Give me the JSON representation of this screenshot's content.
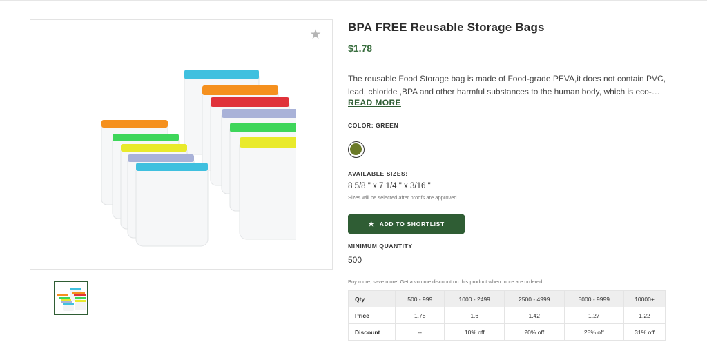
{
  "product": {
    "title": "BPA FREE Reusable Storage Bags",
    "price": "$1.78",
    "description": "The reusable Food Storage bag is made of Food-grade PEVA,it does not contain PVC, lead, chloride ,BPA and other harmful substances to the human body, which is eco-…",
    "read_more": "READ MORE"
  },
  "icons": {
    "favorite": "star-icon",
    "shortlist": "star-icon"
  },
  "color": {
    "label": "COLOR: GREEN",
    "swatches": [
      {
        "name": "Green",
        "hex": "#6b7a28",
        "selected": true
      }
    ]
  },
  "sizes": {
    "label": "AVAILABLE SIZES:",
    "value": "8 5/8 \" x 7 1/4 \" x 3/16 \"",
    "note": "Sizes will be selected after proofs are approved"
  },
  "shortlist": {
    "label": "ADD TO SHORTLIST",
    "color": "#2f5d34"
  },
  "minimum_quantity": {
    "label": "MINIMUM QUANTITY",
    "value": "500"
  },
  "volume": {
    "note": "Buy more, save more! Get a volume discount on this product when more are ordered.",
    "rows": [
      {
        "label": "Qty",
        "cells": [
          "500 - 999",
          "1000 - 2499",
          "2500 - 4999",
          "5000 - 9999",
          "10000+"
        ]
      },
      {
        "label": "Price",
        "cells": [
          "1.78",
          "1.6",
          "1.42",
          "1.27",
          "1.22"
        ]
      },
      {
        "label": "Discount",
        "cells": [
          "--",
          "10% off",
          "20% off",
          "28% off",
          "31% off"
        ]
      }
    ]
  },
  "bag_colors": {
    "cyan": "#3fc0df",
    "orange": "#f5901e",
    "red": "#e0323a",
    "lavender": "#a9b2d8",
    "green": "#3ed65a",
    "yellow": "#e9ea2b"
  }
}
